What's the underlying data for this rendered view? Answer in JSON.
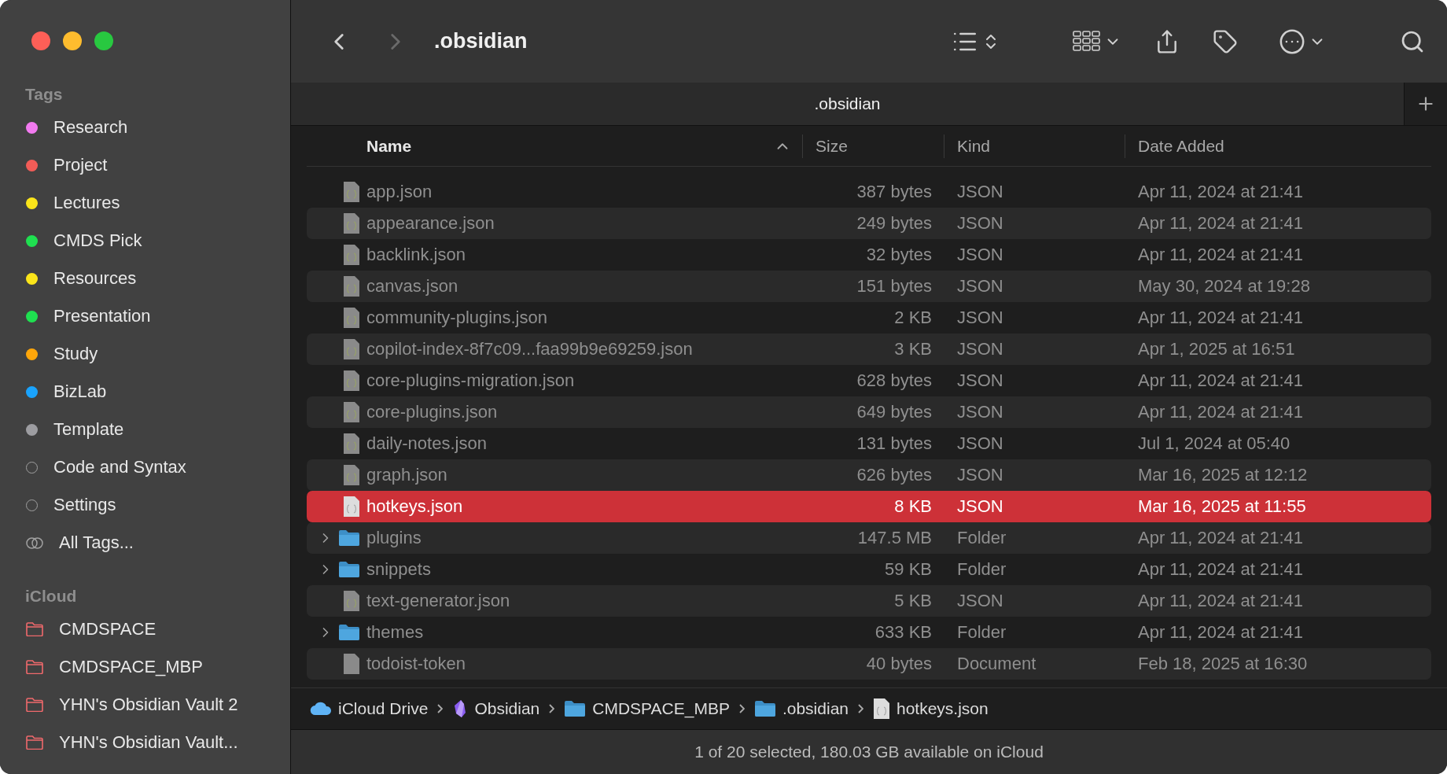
{
  "window": {
    "title": ".obsidian"
  },
  "sidebar": {
    "sections": [
      {
        "title": "Tags",
        "items": [
          {
            "label": "Research",
            "kind": "dot",
            "color": "#f27af0"
          },
          {
            "label": "Project",
            "kind": "dot",
            "color": "#f25c57"
          },
          {
            "label": "Lectures",
            "kind": "dot",
            "color": "#fbe51a"
          },
          {
            "label": "CMDS Pick",
            "kind": "dot",
            "color": "#1fe050"
          },
          {
            "label": "Resources",
            "kind": "dot",
            "color": "#fbe51a"
          },
          {
            "label": "Presentation",
            "kind": "dot",
            "color": "#1fe050"
          },
          {
            "label": "Study",
            "kind": "dot",
            "color": "#fea60a"
          },
          {
            "label": "BizLab",
            "kind": "dot",
            "color": "#1aa3fd"
          },
          {
            "label": "Template",
            "kind": "dot",
            "color": "#9d9da1"
          },
          {
            "label": "Code and Syntax",
            "kind": "ring"
          },
          {
            "label": "Settings",
            "kind": "ring"
          },
          {
            "label": "All Tags...",
            "kind": "all"
          }
        ]
      },
      {
        "title": "iCloud",
        "items": [
          {
            "label": "CMDSPACE",
            "kind": "folder"
          },
          {
            "label": "CMDSPACE_MBP",
            "kind": "folder"
          },
          {
            "label": "YHN's Obsidian Vault 2",
            "kind": "folder"
          },
          {
            "label": "YHN's Obsidian Vault...",
            "kind": "folder"
          }
        ]
      }
    ]
  },
  "tabs": [
    {
      "label": ".obsidian",
      "selected": true
    }
  ],
  "table": {
    "columns": [
      "Name",
      "Size",
      "Kind",
      "Date Added"
    ],
    "rows": [
      {
        "name": "app.json",
        "size": "387 bytes",
        "kind": "file",
        "type": "JSON",
        "date": "Apr 11, 2024 at 21:41",
        "selected": false
      },
      {
        "name": "appearance.json",
        "size": "249 bytes",
        "kind": "file",
        "type": "JSON",
        "date": "Apr 11, 2024 at 21:41",
        "selected": false
      },
      {
        "name": "backlink.json",
        "size": "32 bytes",
        "kind": "file",
        "type": "JSON",
        "date": "Apr 11, 2024 at 21:41",
        "selected": false
      },
      {
        "name": "canvas.json",
        "size": "151 bytes",
        "kind": "file",
        "type": "JSON",
        "date": "May 30, 2024 at 19:28",
        "selected": false
      },
      {
        "name": "community-plugins.json",
        "size": "2 KB",
        "kind": "file",
        "type": "JSON",
        "date": "Apr 11, 2024 at 21:41",
        "selected": false
      },
      {
        "name": "copilot-index-8f7c09...faa99b9e69259.json",
        "size": "3 KB",
        "kind": "file",
        "type": "JSON",
        "date": "Apr 1, 2025 at 16:51",
        "selected": false
      },
      {
        "name": "core-plugins-migration.json",
        "size": "628 bytes",
        "kind": "file",
        "type": "JSON",
        "date": "Apr 11, 2024 at 21:41",
        "selected": false
      },
      {
        "name": "core-plugins.json",
        "size": "649 bytes",
        "kind": "file",
        "type": "JSON",
        "date": "Apr 11, 2024 at 21:41",
        "selected": false
      },
      {
        "name": "daily-notes.json",
        "size": "131 bytes",
        "kind": "file",
        "type": "JSON",
        "date": "Jul 1, 2024 at 05:40",
        "selected": false
      },
      {
        "name": "graph.json",
        "size": "626 bytes",
        "kind": "file",
        "type": "JSON",
        "date": "Mar 16, 2025 at 12:12",
        "selected": false
      },
      {
        "name": "hotkeys.json",
        "size": "8 KB",
        "kind": "file",
        "type": "JSON",
        "date": "Mar 16, 2025 at 11:55",
        "selected": true
      },
      {
        "name": "plugins",
        "size": "147.5 MB",
        "kind": "folder",
        "type": "Folder",
        "date": "Apr 11, 2024 at 21:41",
        "selected": false
      },
      {
        "name": "snippets",
        "size": "59 KB",
        "kind": "folder",
        "type": "Folder",
        "date": "Apr 11, 2024 at 21:41",
        "selected": false
      },
      {
        "name": "text-generator.json",
        "size": "5 KB",
        "kind": "file",
        "type": "JSON",
        "date": "Apr 11, 2024 at 21:41",
        "selected": false
      },
      {
        "name": "themes",
        "size": "633 KB",
        "kind": "folder",
        "type": "Folder",
        "date": "Apr 11, 2024 at 21:41",
        "selected": false
      },
      {
        "name": "todoist-token",
        "size": "40 bytes",
        "kind": "document",
        "type": "Document",
        "date": "Feb 18, 2025 at 16:30",
        "selected": false
      }
    ]
  },
  "path_bar": [
    {
      "label": "iCloud Drive",
      "kind": "cloud"
    },
    {
      "label": "Obsidian",
      "kind": "app"
    },
    {
      "label": "CMDSPACE_MBP",
      "kind": "folder"
    },
    {
      "label": ".obsidian",
      "kind": "folder"
    },
    {
      "label": "hotkeys.json",
      "kind": "file"
    }
  ],
  "status_bar": "1 of 20 selected, 180.03 GB available on iCloud"
}
